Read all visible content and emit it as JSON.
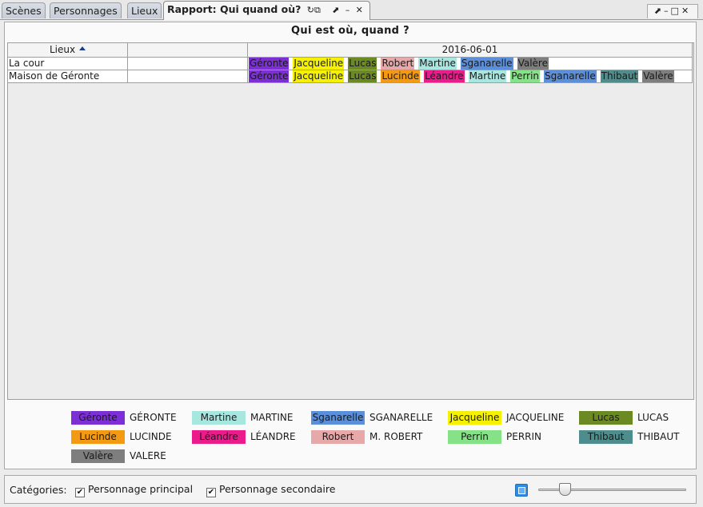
{
  "tabs": [
    {
      "label": "Scènes",
      "active": false
    },
    {
      "label": "Personnages",
      "active": false
    },
    {
      "label": "Lieux",
      "active": false
    },
    {
      "label": "Rapport: Qui quand où?",
      "active": true
    }
  ],
  "active_tab_controls": {
    "refresh": "↻",
    "export": "⧉",
    "undock": "⬈",
    "minimize": "–",
    "close": "✕"
  },
  "window_controls": {
    "undock": "⬈",
    "minimize": "–",
    "maximize": "□",
    "close": "✕"
  },
  "report": {
    "title": "Qui est où, quand ?",
    "column_header_places": "Lieux",
    "column_header_blank": "",
    "column_header_date": "2016-06-01",
    "rows": [
      {
        "place": "La cour",
        "characters": [
          {
            "name": "Géronte",
            "color": "#7b2fd4"
          },
          {
            "name": "Jacqueline",
            "color": "#f5f100"
          },
          {
            "name": "Lucas",
            "color": "#6b8a23"
          },
          {
            "name": "Robert",
            "color": "#e6a8a8"
          },
          {
            "name": "Martine",
            "color": "#a8e6e0"
          },
          {
            "name": "Sganarelle",
            "color": "#5b8fd9"
          },
          {
            "name": "Valère",
            "color": "#7e7e7e"
          }
        ]
      },
      {
        "place": "Maison de Géronte",
        "characters": [
          {
            "name": "Géronte",
            "color": "#7b2fd4"
          },
          {
            "name": "Jacqueline",
            "color": "#f5f100"
          },
          {
            "name": "Lucas",
            "color": "#6b8a23"
          },
          {
            "name": "Lucinde",
            "color": "#f39a12"
          },
          {
            "name": "Léandre",
            "color": "#ec1b8c"
          },
          {
            "name": "Martine",
            "color": "#a8e6e0"
          },
          {
            "name": "Perrin",
            "color": "#86e286"
          },
          {
            "name": "Sganarelle",
            "color": "#5b8fd9"
          },
          {
            "name": "Thibaut",
            "color": "#4e8d8b"
          },
          {
            "name": "Valère",
            "color": "#7e7e7e"
          }
        ]
      }
    ]
  },
  "legend": [
    {
      "short": "Géronte",
      "full": "GÉRONTE",
      "color": "#7b2fd4"
    },
    {
      "short": "Martine",
      "full": "MARTINE",
      "color": "#a8e6e0"
    },
    {
      "short": "Sganarelle",
      "full": "SGANARELLE",
      "color": "#5b8fd9"
    },
    {
      "short": "Jacqueline",
      "full": "JACQUELINE",
      "color": "#f5f100"
    },
    {
      "short": "Lucas",
      "full": "LUCAS",
      "color": "#6b8a23"
    },
    {
      "short": "Lucinde",
      "full": "LUCINDE",
      "color": "#f39a12"
    },
    {
      "short": "Léandre",
      "full": "LÉANDRE",
      "color": "#ec1b8c"
    },
    {
      "short": "Robert",
      "full": "M. ROBERT",
      "color": "#e6a8a8"
    },
    {
      "short": "Perrin",
      "full": "PERRIN",
      "color": "#86e286"
    },
    {
      "short": "Thibaut",
      "full": "THIBAUT",
      "color": "#4e8d8b"
    },
    {
      "short": "Valère",
      "full": "VALERE",
      "color": "#7e7e7e"
    }
  ],
  "bottom_bar": {
    "categories_label": "Catégories:",
    "checkbox_main": {
      "label": "Personnage principal",
      "checked": true
    },
    "checkbox_secondary": {
      "label": "Personnage secondaire",
      "checked": true
    },
    "check_mark": "✔",
    "zoom_slider_value": 0.15
  }
}
